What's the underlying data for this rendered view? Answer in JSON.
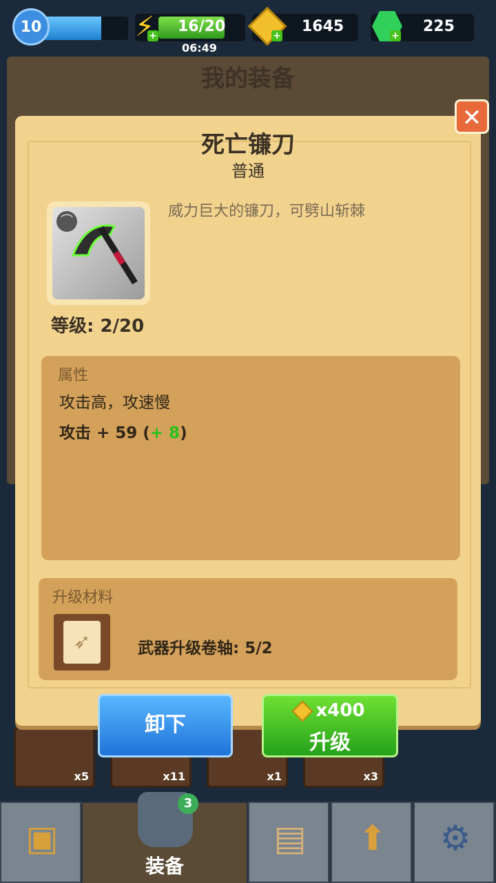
{
  "top": {
    "level": "10",
    "energy": "16/20",
    "energy_timer": "06:49",
    "coins": "1645",
    "gems": "225"
  },
  "background_title": "我的装备",
  "dialog": {
    "name": "死亡镰刀",
    "rarity": "普通",
    "description": "威力巨大的镰刀，可劈山斩棘",
    "level_text": "等级: 2/20",
    "attributes_title": "属性",
    "attr_desc": "攻击高，攻速慢",
    "attack_label": "攻击 + 59 (",
    "attack_bonus": "+ 8",
    "attack_close": ")",
    "materials_title": "升级材料",
    "material_text": "武器升级卷轴: 5/2",
    "unequip": "卸下",
    "upgrade_cost": "x400",
    "upgrade": "升级",
    "close": "✕"
  },
  "inventory_counts": [
    "x5",
    "x11",
    "x1",
    "x3"
  ],
  "nav": {
    "active_label": "装备",
    "badge": "3"
  },
  "colors": {
    "dialog_bg": "#f2d38e",
    "attr_bg": "#d4a15a",
    "unequip_blue": "#1e74d8",
    "upgrade_green": "#25a21a"
  }
}
